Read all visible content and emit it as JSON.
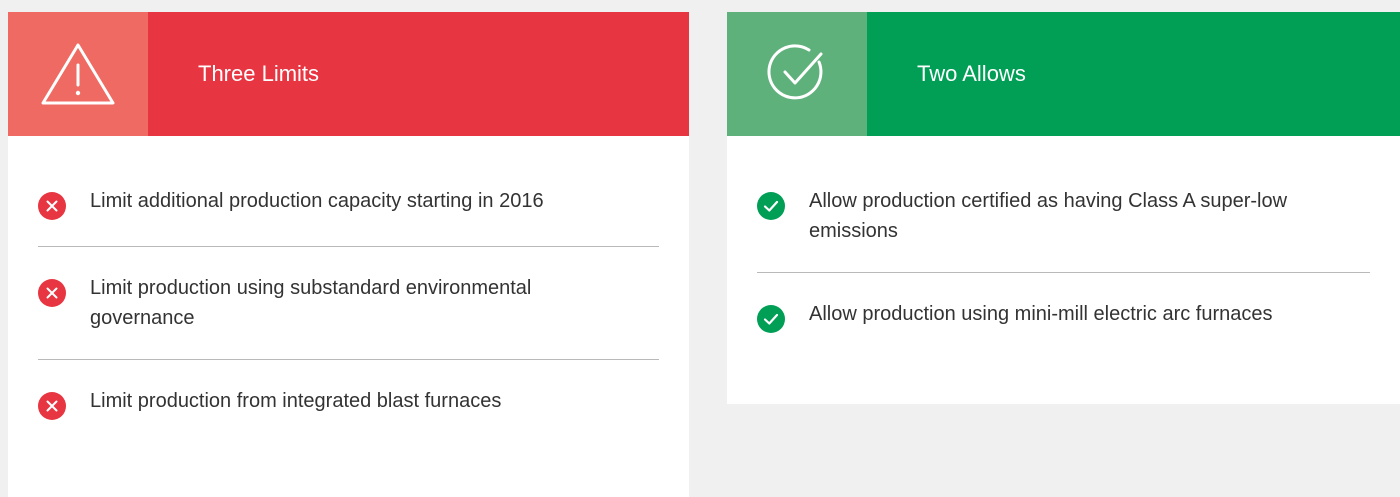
{
  "colors": {
    "limit_icon_bg": "#ef6a62",
    "limit_header_bg": "#e83542",
    "allow_icon_bg": "#5fb17c",
    "allow_header_bg": "#019e56",
    "page_bg": "#f0f0f0"
  },
  "limits": {
    "icon": "warning-triangle-icon",
    "title": "Three Limits",
    "item_icon": "x-circle-icon",
    "items": [
      "Limit additional production capacity starting in 2016",
      "Limit production using substandard environmental governance",
      "Limit production from integrated blast furnaces"
    ]
  },
  "allows": {
    "icon": "check-circle-icon",
    "title": "Two Allows",
    "item_icon": "check-circle-icon",
    "items": [
      "Allow production certified as having Class A super-low emissions",
      "Allow production using mini-mill electric arc furnaces"
    ]
  }
}
